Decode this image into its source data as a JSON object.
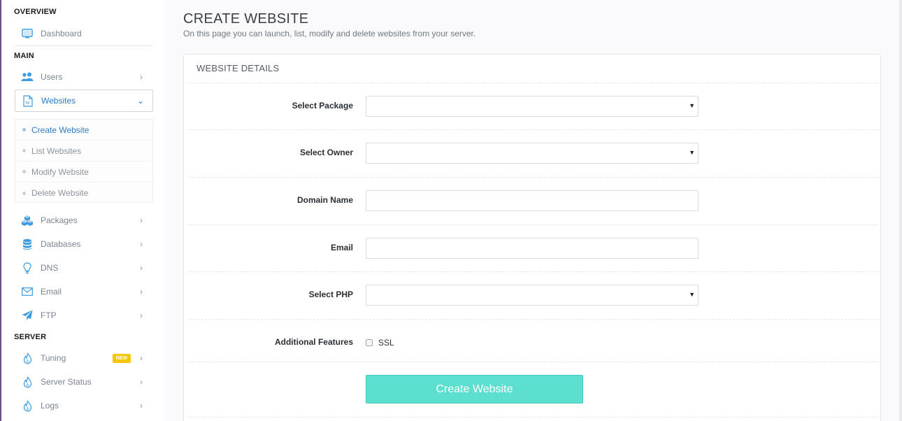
{
  "sidebar": {
    "overview_title": "OVERVIEW",
    "dashboard": {
      "label": "Dashboard",
      "icon": "monitor-icon"
    },
    "main_title": "MAIN",
    "users": {
      "label": "Users",
      "icon": "users-icon"
    },
    "websites": {
      "label": "Websites",
      "icon": "wordpress-doc-icon",
      "expanded": true
    },
    "websites_submenu": [
      {
        "label": "Create Website",
        "current": true
      },
      {
        "label": "List Websites"
      },
      {
        "label": "Modify Website"
      },
      {
        "label": "Delete Website"
      }
    ],
    "packages": {
      "label": "Packages",
      "icon": "cubes-icon"
    },
    "databases": {
      "label": "Databases",
      "icon": "database-icon"
    },
    "dns": {
      "label": "DNS",
      "icon": "lightbulb-icon"
    },
    "email": {
      "label": "Email",
      "icon": "envelope-icon"
    },
    "ftp": {
      "label": "FTP",
      "icon": "paper-plane-icon"
    },
    "server_title": "SERVER",
    "tuning": {
      "label": "Tuning",
      "icon": "flame-icon",
      "badge": "NEW"
    },
    "server_status": {
      "label": "Server Status",
      "icon": "flame-icon"
    },
    "logs": {
      "label": "Logs",
      "icon": "flame-icon"
    }
  },
  "page": {
    "title": "CREATE WEBSITE",
    "subtitle": "On this page you can launch, list, modify and delete websites from your server."
  },
  "form": {
    "panel_title": "WEBSITE DETAILS",
    "package_label": "Select Package",
    "package_value": "",
    "owner_label": "Select Owner",
    "owner_value": "",
    "domain_label": "Domain Name",
    "domain_value": "",
    "email_label": "Email",
    "email_value": "",
    "php_label": "Select PHP",
    "php_value": "",
    "features_label": "Additional Features",
    "ssl_label": "SSL",
    "ssl_checked": false,
    "submit_label": "Create Website"
  },
  "colors": {
    "accent_blue": "#2d7bc4",
    "icon_blue": "#3d9be0",
    "button_teal": "#5ddfd0",
    "badge_yellow": "#f6c700"
  }
}
